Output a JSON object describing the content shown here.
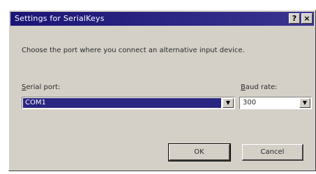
{
  "window": {
    "title": "Settings for SerialKeys",
    "help_glyph": "?",
    "close_glyph": "×"
  },
  "description": "Choose the port where you connect an alternative input device.",
  "serial_port": {
    "label_accel": "S",
    "label_rest": "erial port:",
    "value": "COM1"
  },
  "baud_rate": {
    "label_accel": "B",
    "label_rest": "aud rate:",
    "value": "300"
  },
  "buttons": {
    "ok": "OK",
    "cancel": "Cancel"
  },
  "colors": {
    "title_bar": "#2c2684",
    "selection": "#2a2580",
    "face": "#d4d0c8"
  },
  "icons": {
    "help": "help-icon",
    "close": "close-icon",
    "dropdown": "chevron-down-icon"
  }
}
